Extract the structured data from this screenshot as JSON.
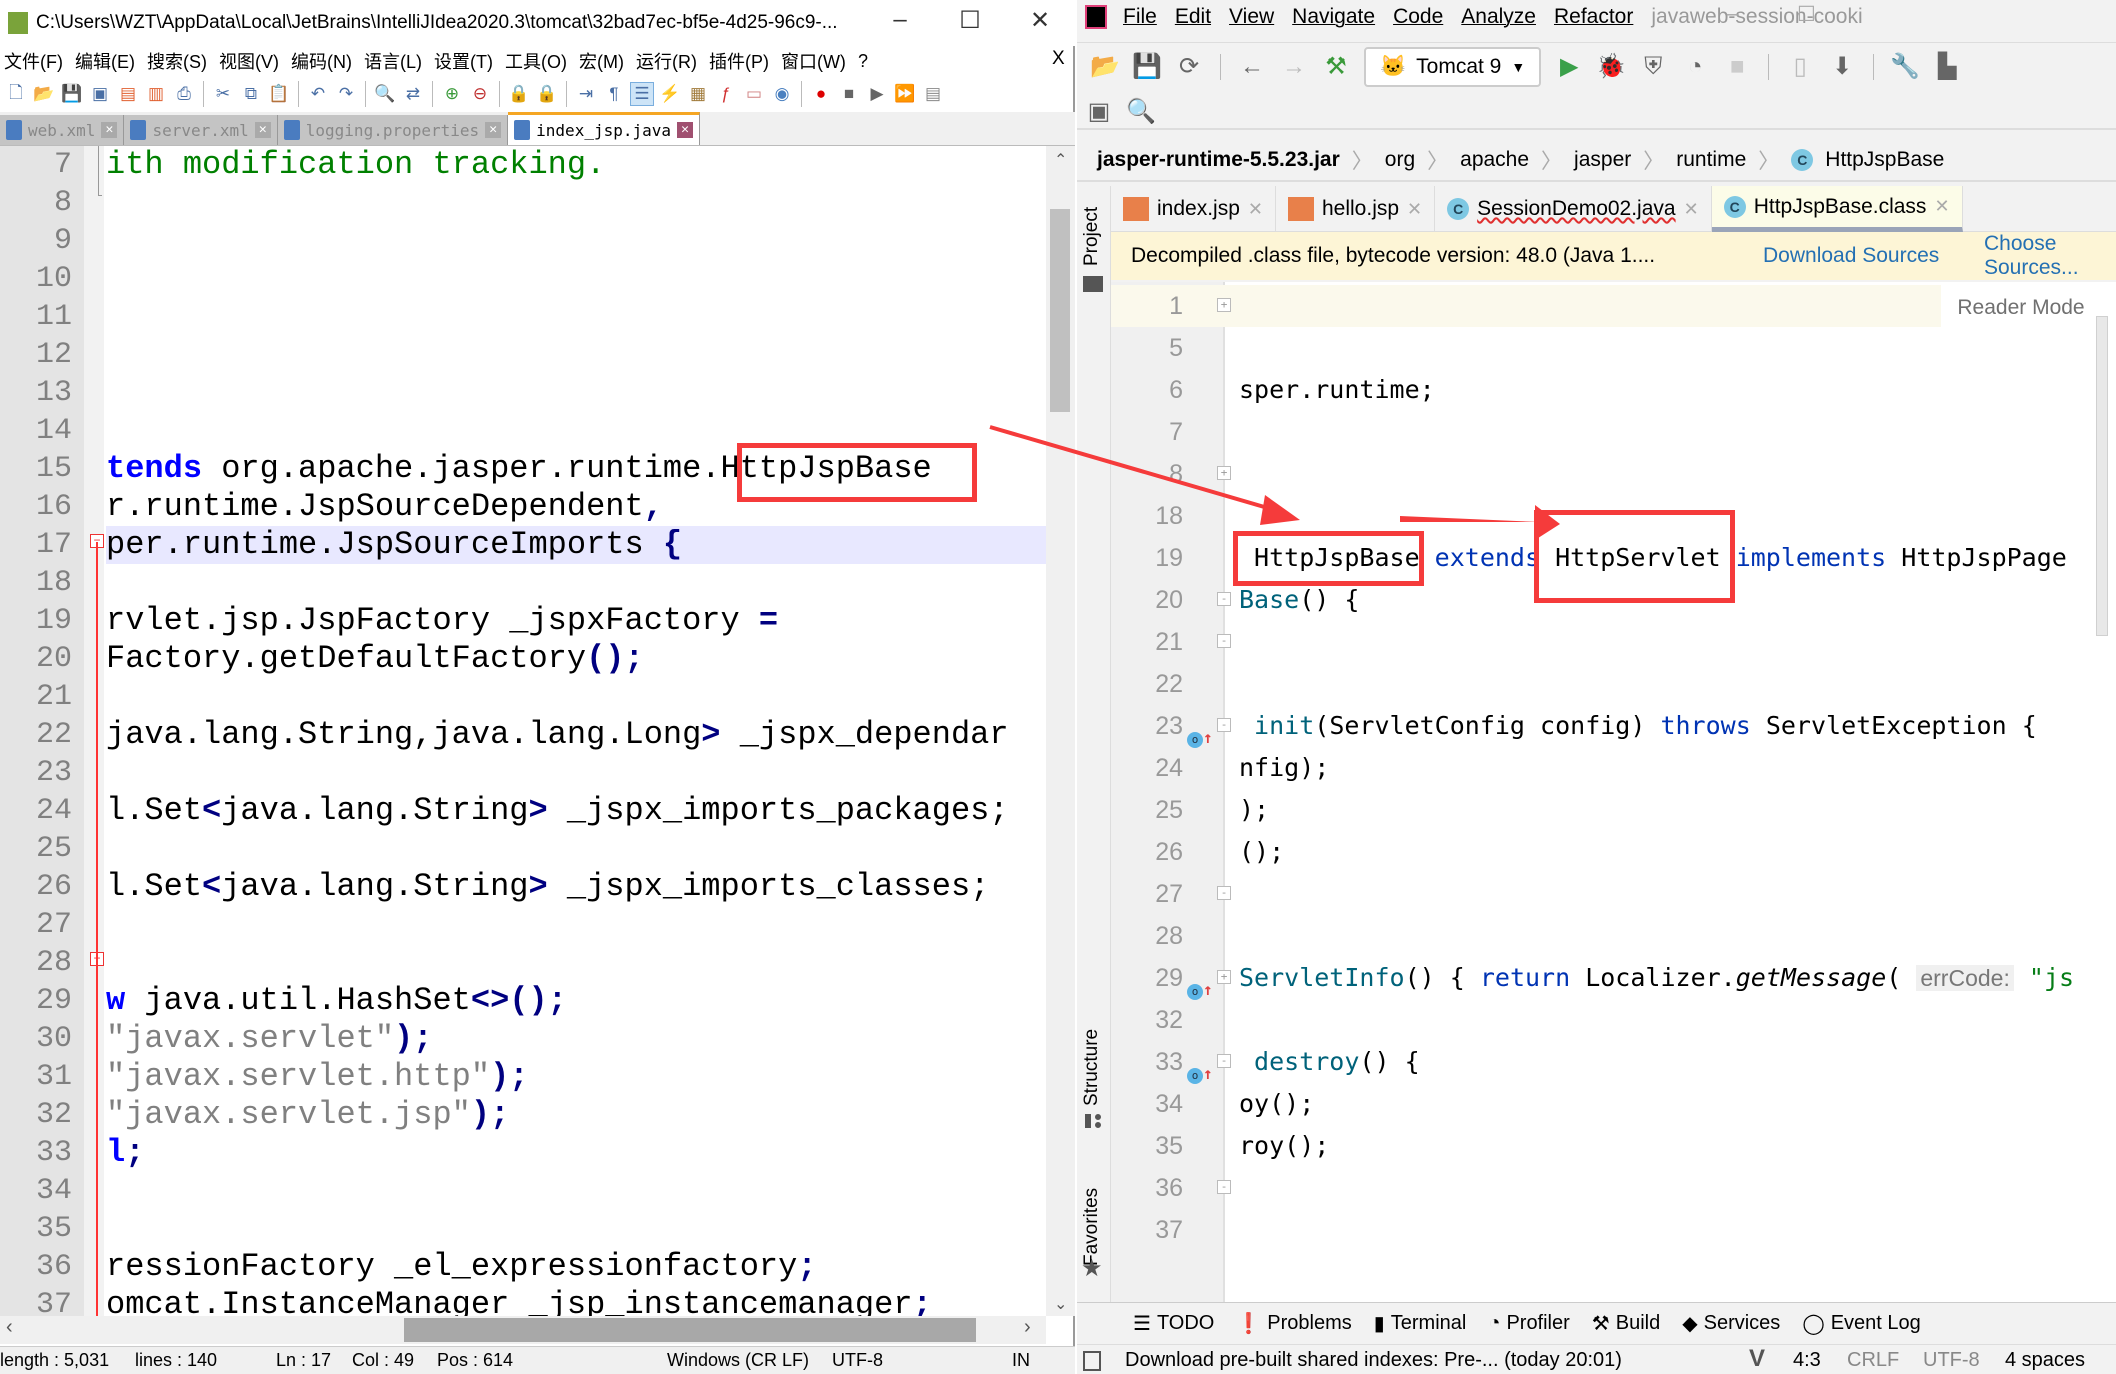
{
  "left_window": {
    "title": "C:\\Users\\WZT\\AppData\\Local\\JetBrains\\IntelliJIdea2020.3\\tomcat\\32bad7ec-bf5e-4d25-96c9-...",
    "close_x": "X",
    "menu": [
      "文件(F)",
      "编辑(E)",
      "搜索(S)",
      "视图(V)",
      "编码(N)",
      "语言(L)",
      "设置(T)",
      "工具(O)",
      "宏(M)",
      "运行(R)",
      "插件(P)",
      "窗口(W)",
      "?"
    ],
    "tabs": [
      {
        "label": "web.xml",
        "active": false
      },
      {
        "label": "server.xml",
        "active": false
      },
      {
        "label": "logging.properties",
        "active": false
      },
      {
        "label": "index_jsp.java",
        "active": true
      }
    ],
    "highlight_color": "#e8e8ff",
    "lines": [
      {
        "n": "7",
        "s": [
          [
            "ith modification tracking.",
            "c-com"
          ]
        ]
      },
      {
        "n": "8",
        "s": []
      },
      {
        "n": "9",
        "s": []
      },
      {
        "n": "10",
        "s": []
      },
      {
        "n": "11",
        "s": []
      },
      {
        "n": "12",
        "s": []
      },
      {
        "n": "13",
        "s": []
      },
      {
        "n": "14",
        "s": []
      },
      {
        "n": "15",
        "s": [
          [
            "tends",
            "c-kw"
          ],
          [
            " org.apache.jasper.runtime.",
            ""
          ],
          [
            "HttpJspBase",
            ""
          ]
        ]
      },
      {
        "n": "16",
        "s": [
          [
            "r.runtime.JspSourceDependent",
            ""
          ],
          [
            ",",
            "c-op"
          ]
        ]
      },
      {
        "n": "17",
        "s": [
          [
            "per.runtime.JspSourceImports ",
            ""
          ],
          [
            "{",
            "c-op"
          ]
        ],
        "hl": true
      },
      {
        "n": "18",
        "s": []
      },
      {
        "n": "19",
        "s": [
          [
            "rvlet.jsp.JspFactory _jspxFactory ",
            ""
          ],
          [
            "=",
            "c-op"
          ]
        ]
      },
      {
        "n": "20",
        "s": [
          [
            "Factory.getDefaultFactory",
            ""
          ],
          [
            "();",
            "c-op"
          ]
        ]
      },
      {
        "n": "21",
        "s": []
      },
      {
        "n": "22",
        "s": [
          [
            "java.lang.String,java.lang.Long",
            ""
          ],
          [
            ">",
            "c-op"
          ],
          [
            " _jspx_dependar",
            ""
          ]
        ]
      },
      {
        "n": "23",
        "s": []
      },
      {
        "n": "24",
        "s": [
          [
            "l.Set",
            ""
          ],
          [
            "<",
            "c-op"
          ],
          [
            "java.lang.String",
            ""
          ],
          [
            ">",
            "c-op"
          ],
          [
            " _jspx_imports_packages;",
            ""
          ]
        ]
      },
      {
        "n": "25",
        "s": []
      },
      {
        "n": "26",
        "s": [
          [
            "l.Set",
            ""
          ],
          [
            "<",
            "c-op"
          ],
          [
            "java.lang.String",
            ""
          ],
          [
            ">",
            "c-op"
          ],
          [
            " _jspx_imports_classes;",
            ""
          ]
        ]
      },
      {
        "n": "27",
        "s": []
      },
      {
        "n": "28",
        "s": []
      },
      {
        "n": "29",
        "s": [
          [
            "w",
            "c-kw"
          ],
          [
            " java.util.HashSet",
            ""
          ],
          [
            "<>();",
            "c-op"
          ]
        ]
      },
      {
        "n": "30",
        "s": [
          [
            "\"javax.servlet\"",
            "c-str"
          ],
          [
            ");",
            "c-op"
          ]
        ]
      },
      {
        "n": "31",
        "s": [
          [
            "\"javax.servlet.http\"",
            "c-str"
          ],
          [
            ");",
            "c-op"
          ]
        ]
      },
      {
        "n": "32",
        "s": [
          [
            "\"javax.servlet.jsp\"",
            "c-str"
          ],
          [
            ");",
            "c-op"
          ]
        ]
      },
      {
        "n": "33",
        "s": [
          [
            "l",
            "c-kw"
          ],
          [
            ";",
            "c-op"
          ]
        ]
      },
      {
        "n": "34",
        "s": []
      },
      {
        "n": "35",
        "s": []
      },
      {
        "n": "36",
        "s": [
          [
            "ressionFactory _el_expressionfactory",
            ""
          ],
          [
            ";",
            "c-op"
          ]
        ]
      },
      {
        "n": "37",
        "s": [
          [
            "omcat.InstanceManager _jsp_instancemanager",
            ""
          ],
          [
            ";",
            "c-op"
          ]
        ]
      }
    ],
    "status": {
      "length": "length : 5,031",
      "lines": "lines : 140",
      "ln": "Ln : 17",
      "col": "Col : 49",
      "pos": "Pos : 614",
      "eol": "Windows (CR LF)",
      "encoding": "UTF-8",
      "mode": "IN"
    }
  },
  "right_window": {
    "menu": [
      "File",
      "Edit",
      "View",
      "Navigate",
      "Code",
      "Analyze",
      "Refactor"
    ],
    "project_title": "javaweb-session-cooki",
    "run_config": "Tomcat 9",
    "breadcrumb": [
      "jasper-runtime-5.5.23.jar",
      "org",
      "apache",
      "jasper",
      "runtime",
      "HttpJspBase"
    ],
    "tabs": [
      {
        "label": "index.jsp",
        "type": "jsp",
        "active": false
      },
      {
        "label": "hello.jsp",
        "type": "jsp",
        "active": false
      },
      {
        "label": "SessionDemo02.java",
        "type": "class",
        "active": false
      },
      {
        "label": "HttpJspBase.class",
        "type": "class",
        "active": true
      }
    ],
    "side_tools": [
      "Project",
      "Structure",
      "Favorites"
    ],
    "banner": {
      "text": "Decompiled .class file, bytecode version: 48.0 (Java 1....",
      "download": "Download Sources",
      "choose": "Choose Sources..."
    },
    "reader_mode": "Reader Mode",
    "lines": [
      {
        "n": "1",
        "s": [],
        "fold": "+"
      },
      {
        "n": "5",
        "s": []
      },
      {
        "n": "6",
        "s": [
          [
            "sper.runtime;",
            ""
          ]
        ]
      },
      {
        "n": "7",
        "s": []
      },
      {
        "n": "8",
        "s": [],
        "fold": "+"
      },
      {
        "n": "18",
        "s": []
      },
      {
        "n": "19",
        "s": [
          [
            " HttpJspBase ",
            ""
          ],
          [
            "extends",
            "r-kw"
          ],
          [
            " HttpServlet ",
            ""
          ],
          [
            "implements",
            "r-kw"
          ],
          [
            " HttpJspPage",
            ""
          ]
        ]
      },
      {
        "n": "20",
        "s": [
          [
            "Base",
            "r-fn"
          ],
          [
            "() {",
            ""
          ]
        ],
        "fold": "-"
      },
      {
        "n": "21",
        "s": [],
        "fold": "-"
      },
      {
        "n": "22",
        "s": []
      },
      {
        "n": "23",
        "s": [
          [
            " init",
            "r-fn"
          ],
          [
            "(ServletConfig config) ",
            ""
          ],
          [
            "throws",
            "r-kw"
          ],
          [
            " ServletException {",
            ""
          ]
        ],
        "fold": "-",
        "ovr": true
      },
      {
        "n": "24",
        "s": [
          [
            "nfig);",
            ""
          ]
        ]
      },
      {
        "n": "25",
        "s": [
          [
            ");",
            ""
          ]
        ]
      },
      {
        "n": "26",
        "s": [
          [
            "();",
            ""
          ]
        ]
      },
      {
        "n": "27",
        "s": [],
        "fold": "-"
      },
      {
        "n": "28",
        "s": []
      },
      {
        "n": "29",
        "s": [
          [
            "ServletInfo",
            "r-fn"
          ],
          [
            "() { ",
            ""
          ],
          [
            "return",
            "r-kw"
          ],
          [
            " Localizer.",
            ""
          ],
          [
            "getMessage",
            "r-it"
          ],
          [
            "( ",
            ""
          ],
          [
            "errCode:",
            "r-hint"
          ],
          [
            " \"js",
            "r-str"
          ]
        ],
        "fold": "+",
        "ovr": true
      },
      {
        "n": "32",
        "s": []
      },
      {
        "n": "33",
        "s": [
          [
            " destroy",
            "r-fn"
          ],
          [
            "() {",
            ""
          ]
        ],
        "fold": "-",
        "ovr": true
      },
      {
        "n": "34",
        "s": [
          [
            "oy();",
            ""
          ]
        ]
      },
      {
        "n": "35",
        "s": [
          [
            "roy();",
            ""
          ]
        ]
      },
      {
        "n": "36",
        "s": [],
        "fold": "-"
      },
      {
        "n": "37",
        "s": []
      }
    ],
    "bottom_tools": [
      "TODO",
      "Problems",
      "Terminal",
      "Profiler",
      "Build",
      "Services",
      "Event Log"
    ],
    "status": {
      "message": "Download pre-built shared indexes: Pre-... (today 20:01)",
      "position": "4:3",
      "eol": "CRLF",
      "encoding": "UTF-8",
      "indent": "4 spaces"
    }
  },
  "annotations": {
    "color": "#f53b3b"
  }
}
